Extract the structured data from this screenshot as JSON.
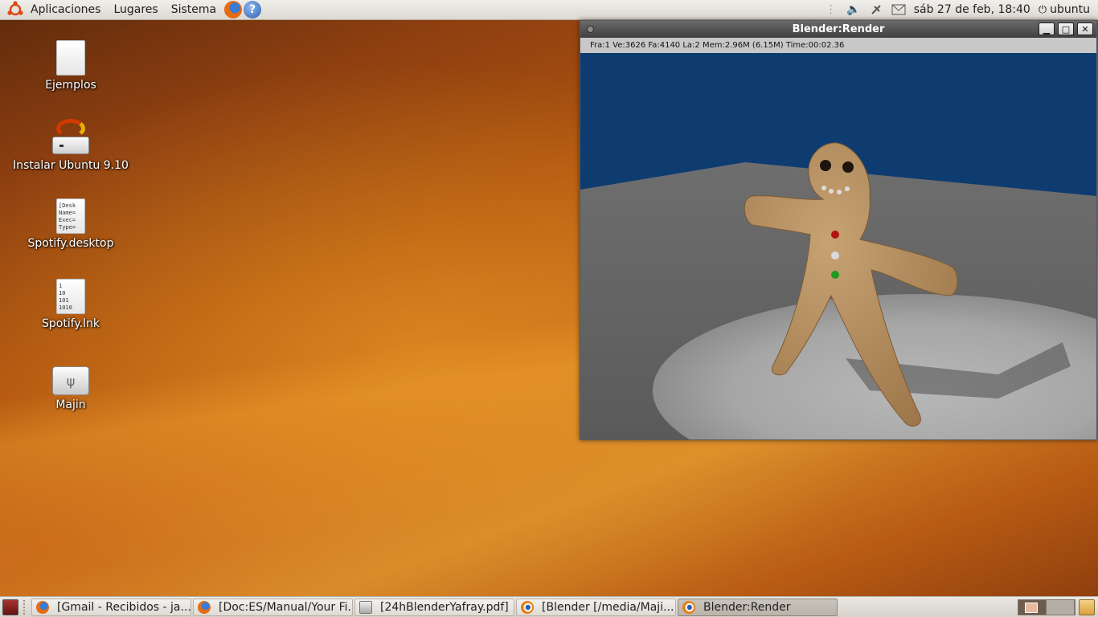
{
  "top_panel": {
    "menus": [
      "Aplicaciones",
      "Lugares",
      "Sistema"
    ],
    "clock": "sáb 27 de feb, 18:40",
    "user": "ubuntu"
  },
  "desktop_icons": [
    {
      "label": "Ejemplos",
      "icon": "folder-icon"
    },
    {
      "label": "Instalar Ubuntu 9.10",
      "icon": "installer-drive-icon"
    },
    {
      "label": "Spotify.desktop",
      "icon": "text-file-icon",
      "preview": "[Desk\nName=\nExec=\nType="
    },
    {
      "label": "Spotify.lnk",
      "icon": "binary-file-icon",
      "preview": "1\n10\n101\n1010"
    },
    {
      "label": "Majin",
      "icon": "usb-drive-icon"
    }
  ],
  "render_window": {
    "title": "Blender:Render",
    "status": "Fra:1   Ve:3626  Fa:4140  La:2  Mem:2.96M (6.15M)  Time:00:02.36"
  },
  "taskbar": {
    "tasks": [
      {
        "label": "[Gmail - Recibidos - ja...",
        "icon": "firefox-icon",
        "active": false
      },
      {
        "label": "[Doc:ES/Manual/Your Fi...",
        "icon": "firefox-icon",
        "active": false
      },
      {
        "label": "[24hBlenderYafray.pdf]",
        "icon": "pdf-icon",
        "active": false
      },
      {
        "label": "[Blender [/media/Maji...",
        "icon": "blender-icon",
        "active": false
      },
      {
        "label": "Blender:Render",
        "icon": "blender-icon",
        "active": true
      }
    ]
  },
  "colors": {
    "accent": "#dd4814",
    "panel": "#e4e1dc",
    "sky": "#0f3c70",
    "cookie": "#b08a5c"
  }
}
